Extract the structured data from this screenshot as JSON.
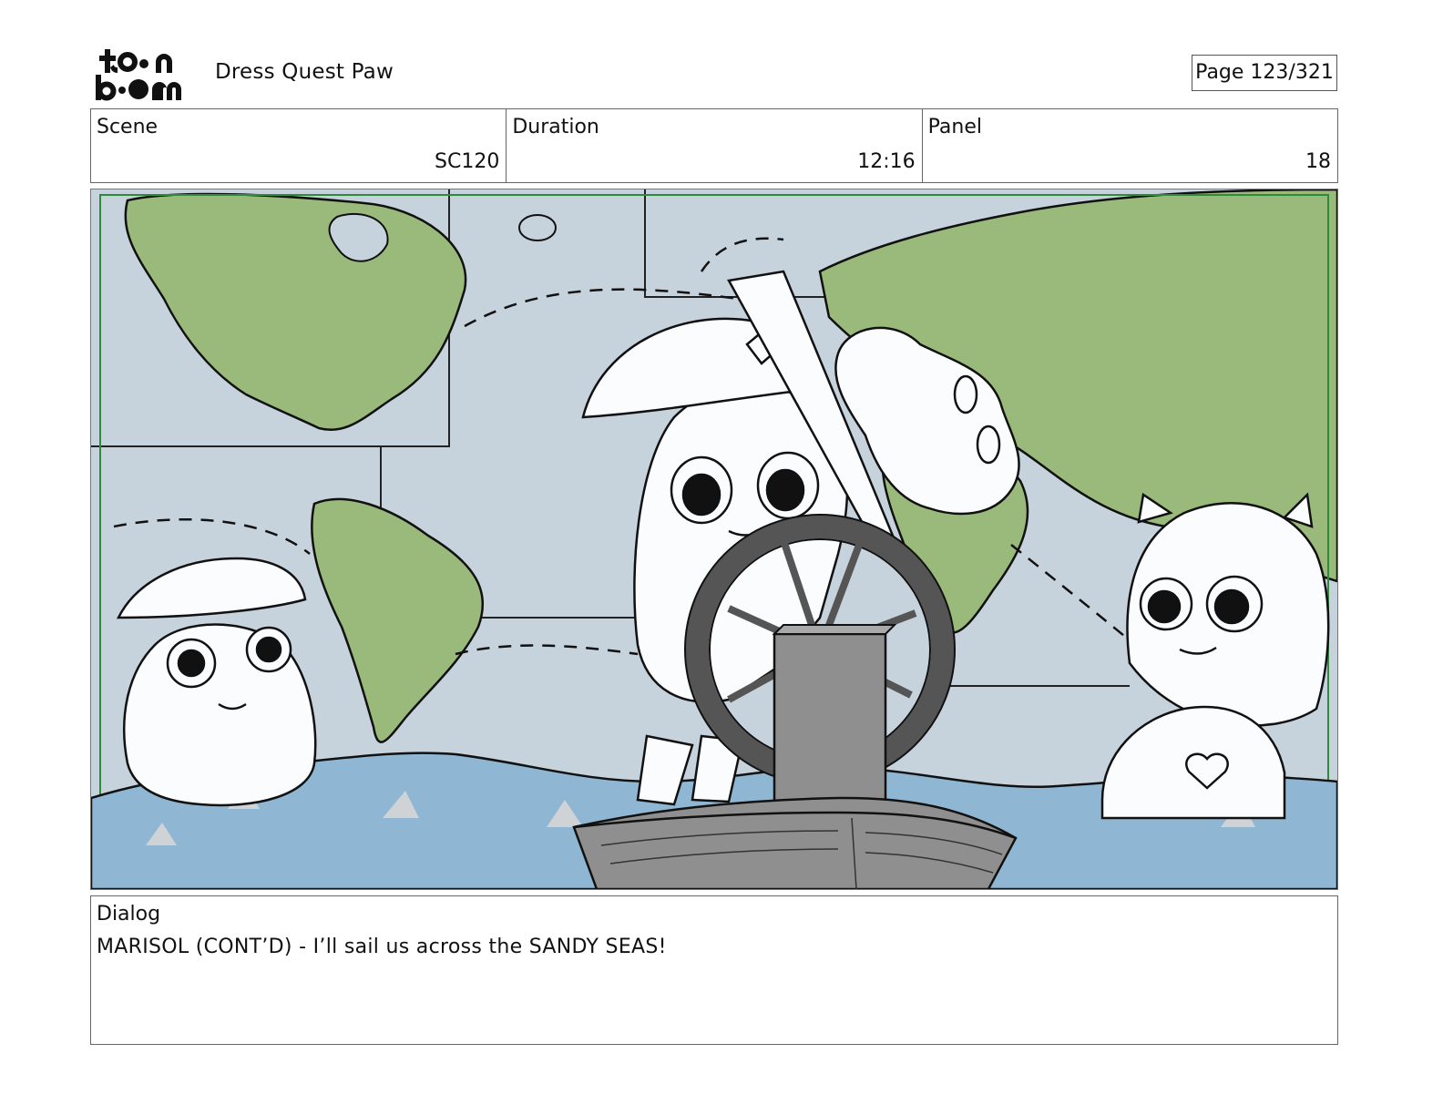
{
  "header": {
    "logo_alt": "toon boom",
    "project_title": "Dress Quest Paw",
    "page_label": "Page 123/321"
  },
  "info": {
    "scene": {
      "label": "Scene",
      "value": "SC120"
    },
    "duration": {
      "label": "Duration",
      "value": "12:16"
    },
    "panel": {
      "label": "Panel",
      "value": "18"
    }
  },
  "panel_image": {
    "description_icons": [
      "world-map",
      "ship-wheel",
      "boat",
      "waves",
      "characters"
    ],
    "colors": {
      "ocean_map": "#c6d2dc",
      "land": "#9aba7b",
      "water": "#8fb7d3",
      "boat": "#8f8f8f",
      "frame_guide": "#2e8b3a"
    }
  },
  "dialog": {
    "label": "Dialog",
    "text": "MARISOL (CONT’D) - I’ll sail us across the SANDY SEAS!"
  }
}
